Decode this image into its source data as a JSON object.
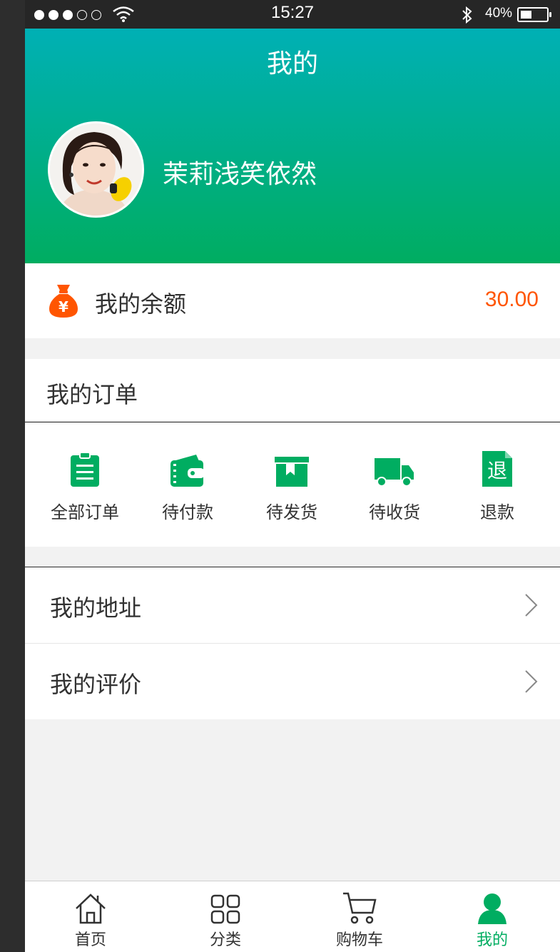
{
  "status_bar": {
    "time": "15:27",
    "battery": "40%"
  },
  "header": {
    "title": "我的",
    "username": "茉莉浅笑依然"
  },
  "balance": {
    "label": "我的余额",
    "value": "30.00",
    "icon": "money-bag-icon",
    "value_color": "#ff5501"
  },
  "orders": {
    "title": "我的订单",
    "items": [
      {
        "label": "全部订单",
        "icon": "clipboard-icon"
      },
      {
        "label": "待付款",
        "icon": "wallet-icon"
      },
      {
        "label": "待发货",
        "icon": "box-icon"
      },
      {
        "label": "待收货",
        "icon": "truck-icon"
      },
      {
        "label": "退款",
        "icon": "refund-icon",
        "icon_text": "退"
      }
    ]
  },
  "menu": [
    {
      "label": "我的地址"
    },
    {
      "label": "我的评价"
    }
  ],
  "tabbar": [
    {
      "label": "首页",
      "icon": "home-icon"
    },
    {
      "label": "分类",
      "icon": "grid-icon"
    },
    {
      "label": "购物车",
      "icon": "cart-icon"
    },
    {
      "label": "我的",
      "icon": "user-icon",
      "active": true
    }
  ],
  "colors": {
    "accent": "#00ad61",
    "text": "#323232",
    "price": "#ff5501"
  }
}
